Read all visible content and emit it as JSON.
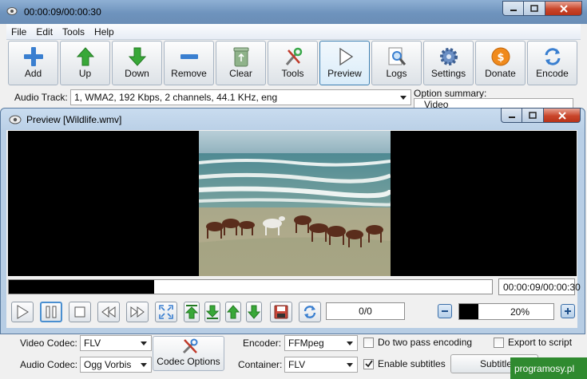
{
  "main": {
    "title": "00:00:09/00:00:30",
    "menu": [
      "File",
      "Edit",
      "Tools",
      "Help"
    ],
    "toolbar": [
      {
        "label": "Add",
        "icon": "plus-icon"
      },
      {
        "label": "Up",
        "icon": "arrow-up-icon"
      },
      {
        "label": "Down",
        "icon": "arrow-down-icon"
      },
      {
        "label": "Remove",
        "icon": "minus-icon"
      },
      {
        "label": "Clear",
        "icon": "recycle-bin-icon"
      },
      {
        "label": "Tools",
        "icon": "tools-icon"
      },
      {
        "label": "Preview",
        "icon": "play-icon"
      },
      {
        "label": "Logs",
        "icon": "magnifier-icon"
      },
      {
        "label": "Settings",
        "icon": "gear-icon"
      },
      {
        "label": "Donate",
        "icon": "donate-icon"
      },
      {
        "label": "Encode",
        "icon": "encode-icon"
      }
    ],
    "audio_track": {
      "label": "Audio Track:",
      "value": "1, WMA2, 192 Kbps, 2 channels, 44.1 KHz, eng"
    },
    "option_summary": {
      "label": "Option summary:",
      "first_item": "Video"
    },
    "bottom": {
      "video_codec_label": "Video Codec:",
      "video_codec_value": "FLV",
      "audio_codec_label": "Audio Codec:",
      "audio_codec_value": "Ogg Vorbis",
      "codec_options_label": "Codec Options",
      "encoder_label": "Encoder:",
      "encoder_value": "FFMpeg",
      "container_label": "Container:",
      "container_value": "FLV",
      "two_pass_label": "Do two pass encoding",
      "two_pass_checked": false,
      "enable_subs_label": "Enable subtitles",
      "enable_subs_checked": true,
      "export_label": "Export to script",
      "export_checked": false,
      "subtitle_button_label": "Subtitle"
    },
    "watermark": "programosy.pl"
  },
  "preview": {
    "title": "Preview [Wildlife.wmv]",
    "time": "00:00:09/00:00:30",
    "seek_progress": 0.3,
    "frame_counter": "0/0",
    "zoom_label": "20%",
    "zoom_value": 0.2,
    "controls": [
      {
        "name": "play-button",
        "icon": "play-icon"
      },
      {
        "name": "pause-button",
        "icon": "pause-icon"
      },
      {
        "name": "stop-button",
        "icon": "stop-icon"
      },
      {
        "name": "rewind-button",
        "icon": "rewind-icon"
      },
      {
        "name": "fast-forward-button",
        "icon": "fast-forward-icon"
      },
      {
        "name": "fullscreen-button",
        "icon": "fullscreen-icon"
      },
      {
        "name": "mark-start-button",
        "icon": "arrow-up-bar-icon"
      },
      {
        "name": "mark-end-button",
        "icon": "arrow-down-bar-icon"
      },
      {
        "name": "step-up-button",
        "icon": "arrow-up-icon"
      },
      {
        "name": "step-down-button",
        "icon": "arrow-down-icon"
      },
      {
        "name": "save-frame-button",
        "icon": "floppy-icon"
      },
      {
        "name": "refresh-button",
        "icon": "refresh-icon"
      }
    ]
  },
  "colors": {
    "titlebar": "#6e93bd",
    "close": "#c9452a",
    "green_arrow": "#38a838",
    "blue_accent": "#3a7fd0",
    "watermark": "#2f8a2f"
  }
}
